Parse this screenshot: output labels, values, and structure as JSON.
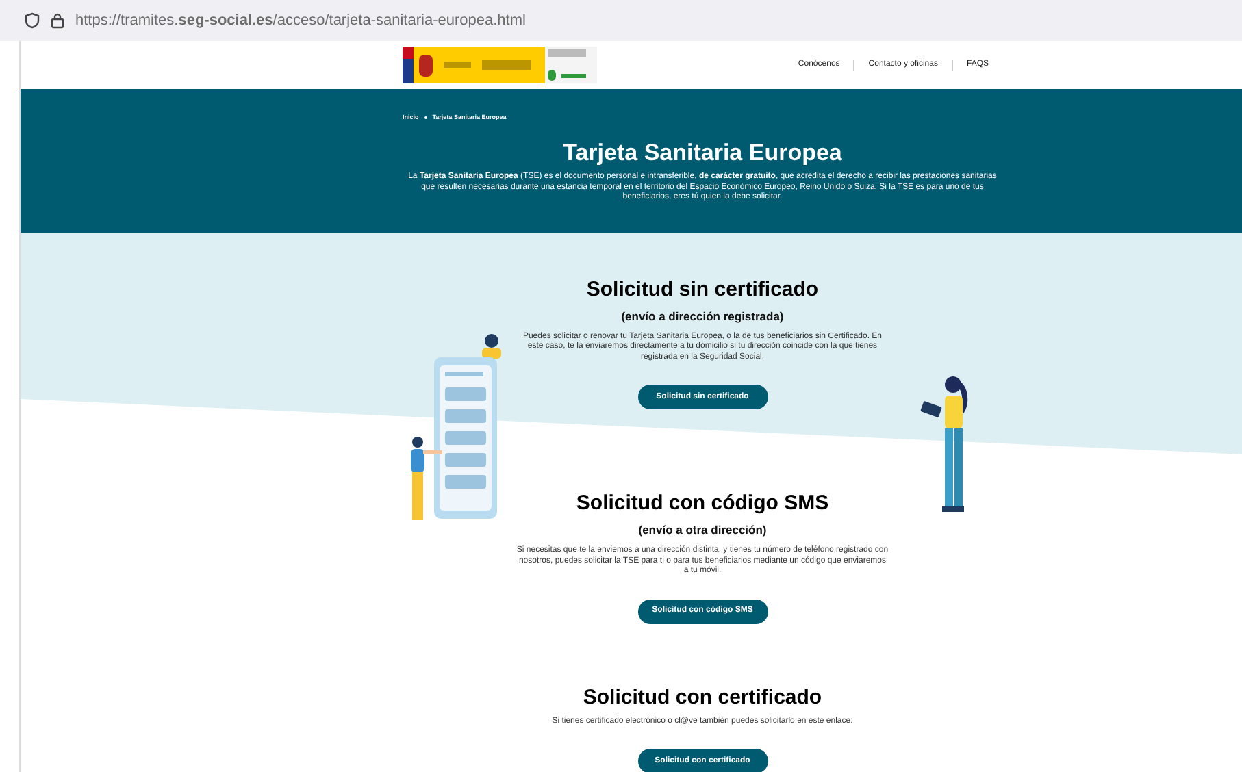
{
  "address_bar": {
    "url": "https://tramites.**seg-social.es**/acceso/tarjeta-sanitaria-europea.html"
  },
  "nav": [
    "Conócenos",
    "Contacto y oficinas",
    "FAQS"
  ],
  "breadcrumb": [
    "Inicio",
    "Tarjeta Sanitaria Europea"
  ],
  "hero": {
    "title": "Tarjeta Sanitaria Europea",
    "text": "La **Tarjeta Sanitaria Europea** (TSE) es el documento personal e intransferible, **de carácter gratuito**, que acredita el derecho a recibir las prestaciones sanitarias que resulten necesarias durante una estancia temporal en el territorio del Espacio Económico Europeo, Reino Unido o Suiza. Si la TSE es para uno de tus beneficiarios, eres tú quien la debe solicitar."
  },
  "sections": [
    {
      "title": "Solicitud sin certificado",
      "subtitle": "(envío a dirección registrada)",
      "text": "Puedes solicitar o renovar tu Tarjeta Sanitaria Europea, o la de tus beneficiarios sin Certificado. En este caso, te la enviaremos directamente a tu domicilio si tu dirección coincide con la que tienes registrada en la Seguridad Social.",
      "button": "Solicitud sin certificado"
    },
    {
      "title": "Solicitud con código SMS",
      "subtitle": "(envío a otra dirección)",
      "text": "Si necesitas que te la enviemos a una dirección distinta, y tienes tu número de teléfono registrado con nosotros, puedes solicitar la TSE para ti o para tus beneficiarios mediante un código que enviaremos a tu móvil.",
      "button": "Solicitud con código SMS"
    },
    {
      "title": "Solicitud con certificado",
      "text": "Si tienes certificado electrónico o cl@ve también puedes solicitarlo en este enlace:",
      "button": "Solicitud con certificado"
    }
  ]
}
